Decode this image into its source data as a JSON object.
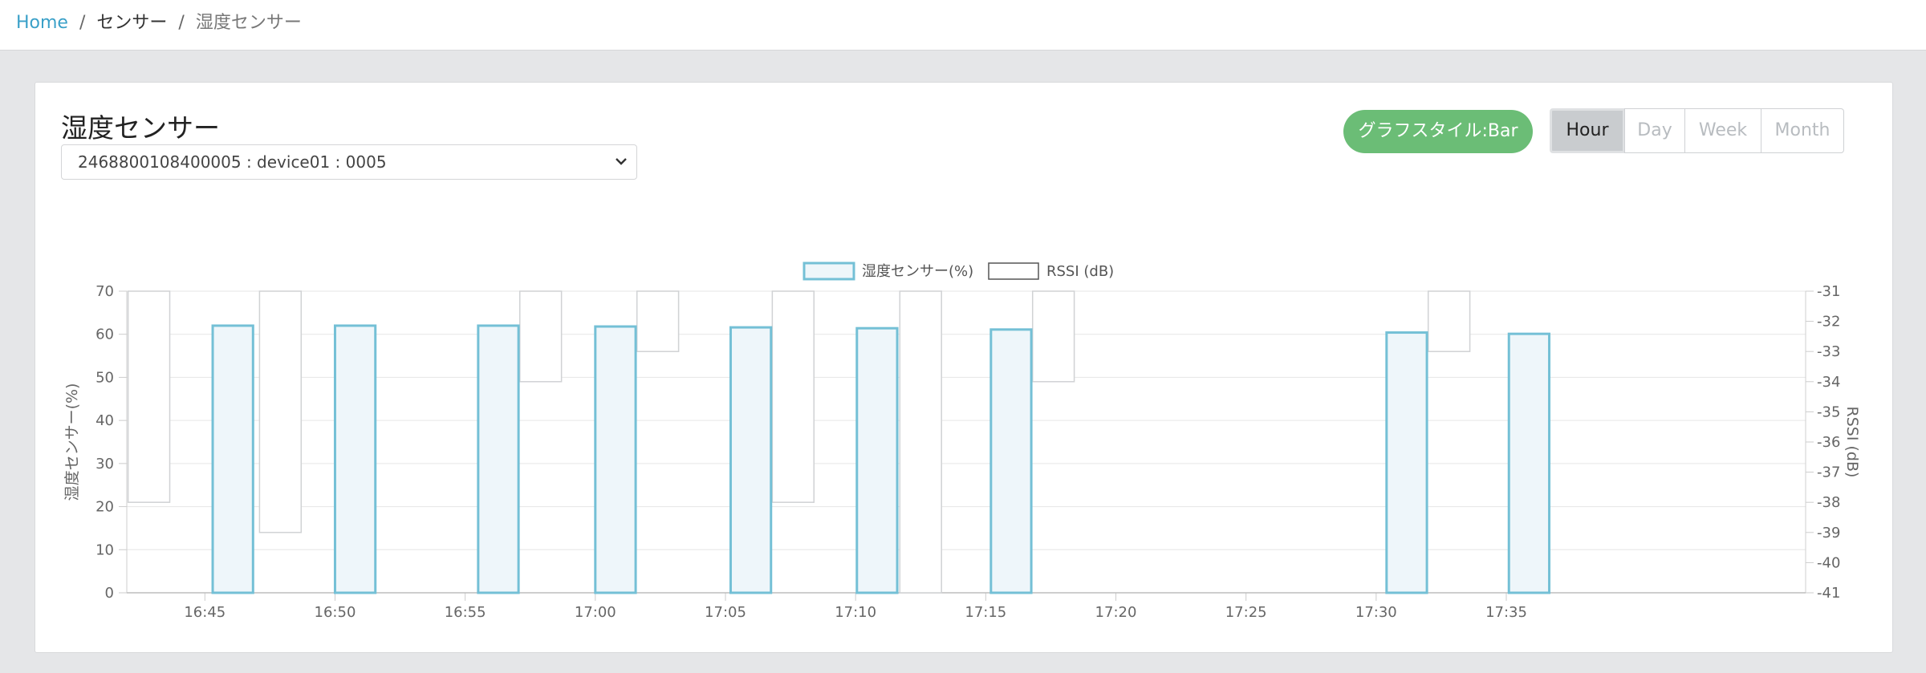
{
  "breadcrumb": {
    "home": "Home",
    "sep": "/",
    "section": "センサー",
    "current": "湿度センサー"
  },
  "card": {
    "title": "湿度センサー",
    "device_select": "2468800108400005 : device01 : 0005",
    "style_button": "グラフスタイル:Bar",
    "ranges": [
      "Hour",
      "Day",
      "Week",
      "Month"
    ],
    "active_range": "Hour"
  },
  "colors": {
    "humidity_fill": "#eef6fa",
    "humidity_stroke": "#74c0d6",
    "rssi_stroke": "#d0d2d4",
    "grid": "#e6e6e6",
    "axis_text": "#666666"
  },
  "chart_data": {
    "type": "bar",
    "legend": [
      "湿度センサー(%)",
      "RSSI (dB)"
    ],
    "legend_position": "top-center",
    "x_ticks": [
      "16:45",
      "16:50",
      "16:55",
      "17:00",
      "17:05",
      "17:10",
      "17:15",
      "17:20",
      "17:25",
      "17:30",
      "17:35"
    ],
    "x_domain_minutes": [
      0,
      64.5
    ],
    "y_left": {
      "label": "湿度センサー(%)",
      "min": 0,
      "max": 70,
      "ticks": [
        0,
        10,
        20,
        30,
        40,
        50,
        60,
        70
      ]
    },
    "y_right": {
      "label": "RSSI (dB)",
      "min": -41,
      "max": -31,
      "ticks": [
        -31,
        -32,
        -33,
        -34,
        -35,
        -36,
        -37,
        -38,
        -39,
        -40,
        -41
      ]
    },
    "grid": true,
    "series": [
      {
        "name": "湿度センサー(%)",
        "axis": "left",
        "points": [
          {
            "x": 3.3,
            "w": 1.55,
            "y": 62
          },
          {
            "x": 8.0,
            "w": 1.55,
            "y": 62
          },
          {
            "x": 13.5,
            "w": 1.55,
            "y": 62
          },
          {
            "x": 18.0,
            "w": 1.55,
            "y": 61.8
          },
          {
            "x": 23.2,
            "w": 1.55,
            "y": 61.6
          },
          {
            "x": 28.05,
            "w": 1.55,
            "y": 61.4
          },
          {
            "x": 33.2,
            "w": 1.55,
            "y": 61.1
          },
          {
            "x": 48.4,
            "w": 1.55,
            "y": 60.4
          },
          {
            "x": 53.1,
            "w": 1.55,
            "y": 60.1
          }
        ]
      },
      {
        "name": "RSSI (dB)",
        "axis": "right",
        "points": [
          {
            "x": 0.05,
            "w": 1.6,
            "y": -38
          },
          {
            "x": 5.1,
            "w": 1.6,
            "y": -39
          },
          {
            "x": 15.1,
            "w": 1.6,
            "y": -34
          },
          {
            "x": 19.6,
            "w": 1.6,
            "y": -33
          },
          {
            "x": 24.8,
            "w": 1.6,
            "y": -38
          },
          {
            "x": 29.7,
            "w": 1.6,
            "y": -41
          },
          {
            "x": 34.8,
            "w": 1.6,
            "y": -34
          },
          {
            "x": 50.0,
            "w": 1.6,
            "y": -33
          }
        ]
      }
    ]
  }
}
